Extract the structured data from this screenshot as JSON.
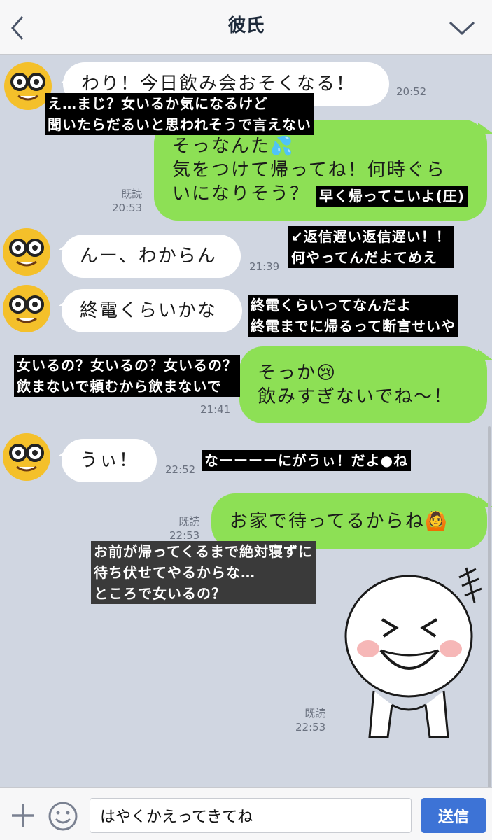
{
  "header": {
    "title": "彼氏",
    "back_icon": "chevron-left-icon",
    "menu_icon": "chevron-down-icon"
  },
  "messages": [
    {
      "text": "わり！今日飲み会おそくなる！",
      "time": "20:52"
    },
    {
      "line1": "そっなんた💦",
      "line2": "気をつけて帰ってね！何時ぐら",
      "line3": "いになりそう？",
      "read": "既読",
      "time": "20:53"
    },
    {
      "text": "んー、わからん",
      "time": "21:39"
    },
    {
      "text": "終電くらいかな"
    },
    {
      "line1": "そっか😢",
      "line2": "飲みすぎないでね〜！",
      "time": "21:41"
    },
    {
      "text": "うぃ！",
      "time": "22:52"
    },
    {
      "text": "お家で待ってるからね🙆",
      "read": "既読",
      "time": "22:53"
    },
    {
      "read": "既読",
      "time": "22:53"
    }
  ],
  "captions": {
    "c1": "え…まじ？女いるか気になるけど\n聞いたらだるいと思われそうで言えない",
    "c2": "早く帰ってこいよ(圧)",
    "c3": "↙返信遅い返信遅い！！\n何やってんだよてめえ",
    "c4": "終電くらいってなんだよ\n終電までに帰るって断言せいや",
    "c5": "女いるの？女いるの？女いるの？\n飲まないで頼むから飲まないで",
    "c6": "なーーーーにがうぃ！だよ●ね",
    "c7": "お前が帰ってくるまで絶対寝ずに\n待ち伏せてやるからな…\nところで女いるの？"
  },
  "input": {
    "value": "はやくかえってきてね",
    "send_label": "送信",
    "plus_icon": "plus-icon",
    "emoji_icon": "smiley-icon"
  },
  "colors": {
    "background": "#d0d6e1",
    "outgoing_bubble": "#8de055",
    "incoming_bubble": "#ffffff",
    "send_button": "#3d73d6"
  }
}
